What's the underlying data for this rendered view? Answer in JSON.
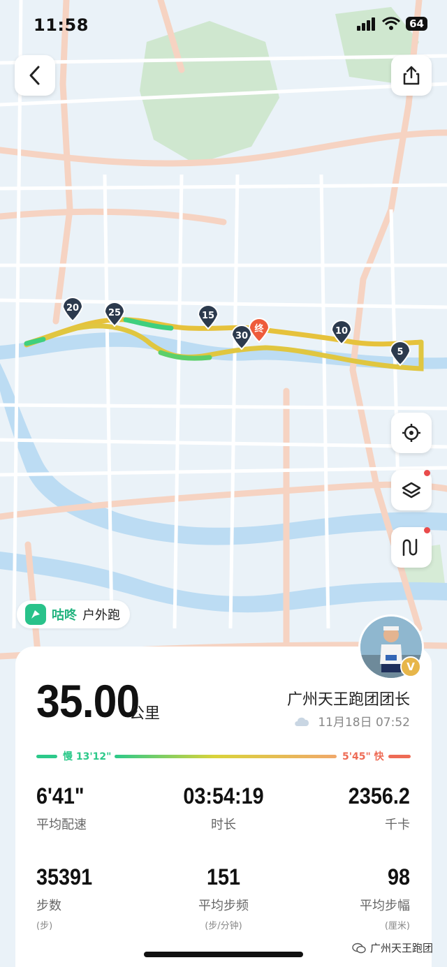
{
  "status_bar": {
    "time": "11:58",
    "battery": "64"
  },
  "map": {
    "markers": [
      "20",
      "25",
      "15",
      "30",
      "终",
      "10",
      "5"
    ]
  },
  "brand": {
    "name": "咕咚",
    "type": "户外跑"
  },
  "summary": {
    "distance": "35.00",
    "distance_unit": "公里",
    "owner": "广州天王跑团团长",
    "datetime": "11月18日  07:52",
    "pace_slow_label": "慢 13'12\"",
    "pace_fast_label": "5'45\" 快"
  },
  "stats": {
    "pace": {
      "value": "6'41\"",
      "label": "平均配速"
    },
    "duration": {
      "value": "03:54:19",
      "label": "时长"
    },
    "calories": {
      "value": "2356.2",
      "label": "千卡"
    },
    "steps": {
      "value": "35391",
      "label": "步数",
      "sub": "(步)"
    },
    "cadence": {
      "value": "151",
      "label": "平均步频",
      "sub": "(步/分钟)"
    },
    "stride": {
      "value": "98",
      "label": "平均步幅",
      "sub": "(厘米)"
    }
  },
  "watermark": "广州天王跑团",
  "colors": {
    "route": "#e8c33a",
    "route_fast": "#f0a23a",
    "route_slow": "#3fcf7e",
    "marker": "#2c3a4d",
    "end_marker": "#ee5b3b",
    "pace_slow": "#2cc98a",
    "pace_fast": "#ee6b55"
  }
}
